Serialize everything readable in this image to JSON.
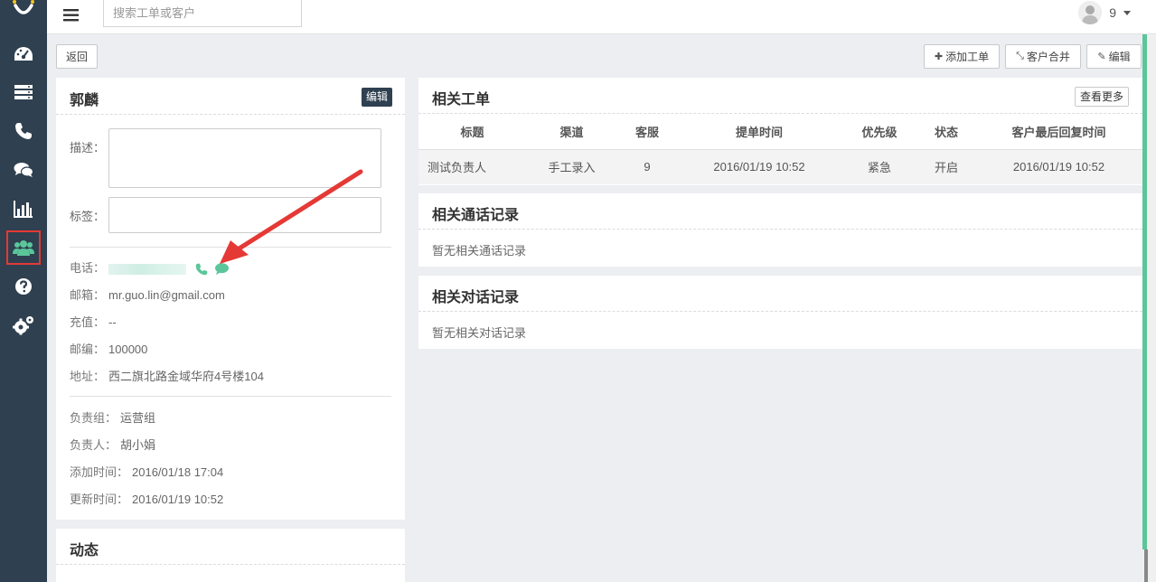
{
  "topbar": {
    "search_placeholder": "搜索工单或客户",
    "user_name": "9"
  },
  "sidebar": {
    "items": [
      {
        "icon": "dashboard-icon"
      },
      {
        "icon": "server-icon"
      },
      {
        "icon": "phone-icon"
      },
      {
        "icon": "chat-icon"
      },
      {
        "icon": "bar-chart-icon"
      },
      {
        "icon": "users-icon",
        "active": true
      },
      {
        "icon": "help-icon"
      },
      {
        "icon": "settings-icon"
      }
    ]
  },
  "actions": {
    "back": "返回",
    "add_ticket": "添加工单",
    "merge_customer": "客户合并",
    "edit": "编辑"
  },
  "customer": {
    "name": "郭麟",
    "edit_label": "编辑",
    "description_label": "描述：",
    "tags_label": "标签：",
    "phone_label": "电话：",
    "email_label": "邮箱：",
    "email": "mr.guo.lin@gmail.com",
    "recharge_label": "充值：",
    "recharge": "--",
    "zip_label": "邮编：",
    "zip": "100000",
    "address_label": "地址：",
    "address": "西二旗北路金域华府4号楼104",
    "group_label": "负责组：",
    "group": "运营组",
    "owner_label": "负责人：",
    "owner": "胡小娟",
    "created_label": "添加时间：",
    "created": "2016/01/18 17:04",
    "updated_label": "更新时间：",
    "updated": "2016/01/19 10:52"
  },
  "activity": {
    "title": "动态"
  },
  "tickets": {
    "title": "相关工单",
    "more": "查看更多",
    "columns": [
      "标题",
      "渠道",
      "客服",
      "提单时间",
      "优先级",
      "状态",
      "客户最后回复时间"
    ],
    "rows": [
      [
        "测试负责人",
        "手工录入",
        "9",
        "2016/01/19 10:52",
        "紧急",
        "开启",
        "2016/01/19 10:52"
      ]
    ]
  },
  "calls": {
    "title": "相关通话记录",
    "empty": "暂无相关通话记录"
  },
  "chats": {
    "title": "相关对话记录",
    "empty": "暂无相关对话记录"
  },
  "colors": {
    "sidebar": "#2f4050",
    "accent_green": "#5bc69a",
    "highlight_red": "#e53935"
  }
}
